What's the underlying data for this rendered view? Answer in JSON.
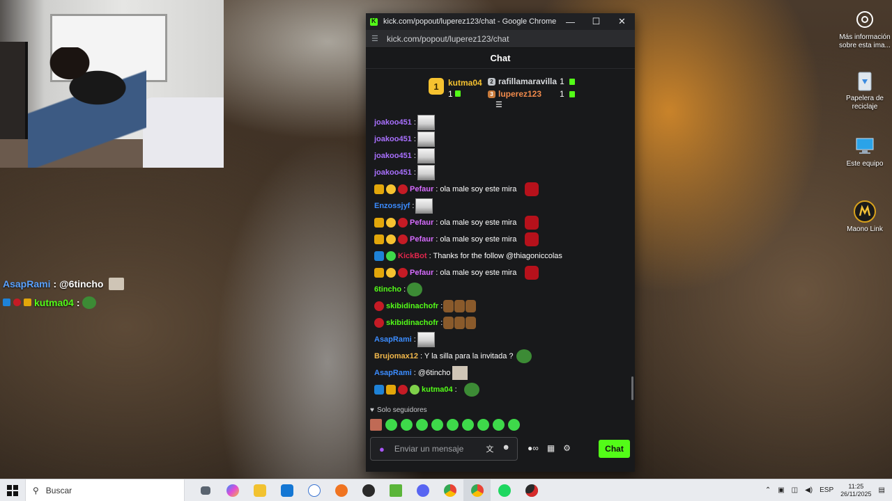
{
  "overlay_chat": [
    {
      "user": "AsapRami",
      "text": " : @6tincho"
    },
    {
      "user": "kutma04",
      "text": " :"
    }
  ],
  "desktop_icons": [
    {
      "label": "Más información sobre esta ima..."
    },
    {
      "label": "Papelera de reciclaje"
    },
    {
      "label": "Este equipo"
    },
    {
      "label": "Maono Link"
    }
  ],
  "browser": {
    "title": "kick.com/popout/luperez123/chat - Google Chrome",
    "url": "kick.com/popout/luperez123/chat",
    "controls": {
      "minimize": "—",
      "maximize": "☐",
      "close": "✕"
    }
  },
  "chat": {
    "header": "Chat",
    "leaderboard": {
      "first": {
        "rank": "1",
        "name": "kutma04",
        "count": "1"
      },
      "second": {
        "rank": "2",
        "name": "rafillamaravilla",
        "count": "1"
      },
      "third": {
        "rank": "3",
        "name": "luperez123",
        "count": "1"
      }
    },
    "messages": [
      {
        "user": "joakoo451",
        "text": ":",
        "color": "#a970ff"
      },
      {
        "user": "joakoo451",
        "text": ":",
        "color": "#a970ff"
      },
      {
        "user": "joakoo451",
        "text": ":",
        "color": "#a970ff"
      },
      {
        "user": "joakoo451",
        "text": ":",
        "color": "#a970ff"
      },
      {
        "user": "Pefaur",
        "text": ": ola male soy este mira",
        "color": "#d66bff"
      },
      {
        "user": "Enzossjyf",
        "text": ":",
        "color": "#3b8cff"
      },
      {
        "user": "Pefaur",
        "text": ": ola male soy este mira",
        "color": "#d66bff"
      },
      {
        "user": "Pefaur",
        "text": ": ola male soy este mira",
        "color": "#d66bff"
      },
      {
        "user": "KickBot",
        "text": ": Thanks for the follow @thiagoniccolas",
        "color": "#e0264c"
      },
      {
        "user": "Pefaur",
        "text": ": ola male soy este mira",
        "color": "#d66bff"
      },
      {
        "user": "6tincho",
        "text": ":",
        "color": "#53fc18"
      },
      {
        "user": "skibidinachofr",
        "text": ":",
        "color": "#53fc18"
      },
      {
        "user": "skibidinachofr",
        "text": ":",
        "color": "#53fc18"
      },
      {
        "user": "AsapRami",
        "text": ":",
        "color": "#3b8cff"
      },
      {
        "user": "Brujomax12",
        "text": ": Y la silla para la invitada ?",
        "color": "#f2b84b"
      },
      {
        "user": "AsapRami",
        "text": ": @6tincho",
        "color": "#3b8cff"
      },
      {
        "user": "kutma04",
        "text": ":",
        "color": "#53fc18"
      }
    ],
    "followers_only": "Solo seguidores",
    "input_placeholder": "Enviar un mensaje",
    "send_label": "Chat"
  },
  "taskbar": {
    "search_label": "Buscar",
    "lang": "ESP",
    "time": "11:25",
    "date": "26/11/2025"
  }
}
